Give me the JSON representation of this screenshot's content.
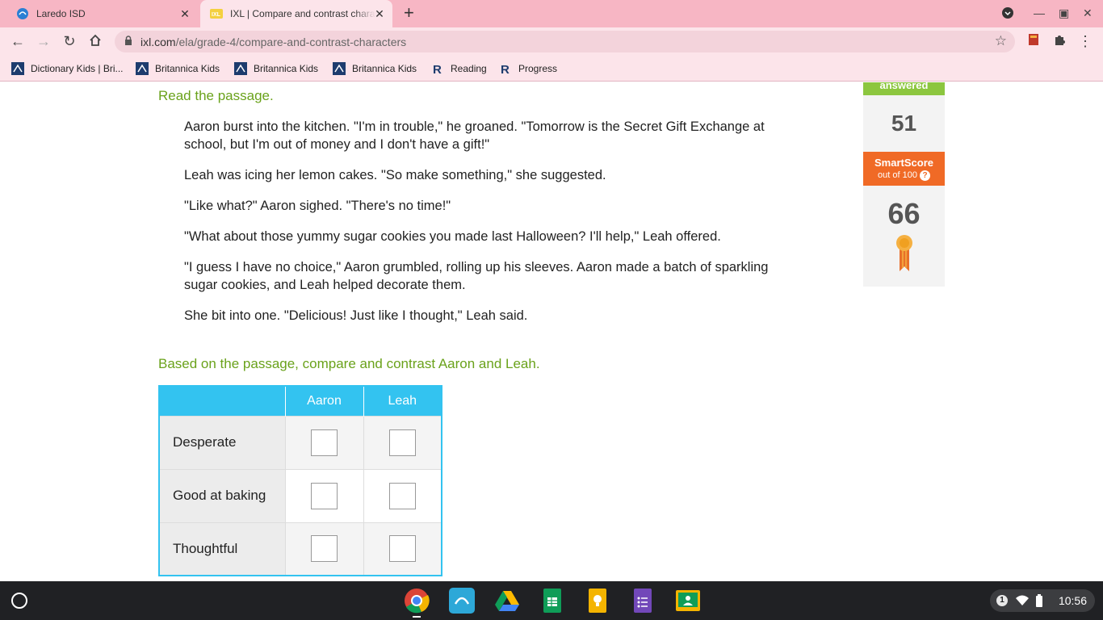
{
  "tabs": [
    {
      "title": "Laredo ISD",
      "icon": "laredo-isd-icon"
    },
    {
      "title": "IXL | Compare and contrast characters",
      "icon": "ixl-icon",
      "active": true
    }
  ],
  "address_bar": {
    "domain": "ixl.com",
    "path": "/ela/grade-4/compare-and-contrast-characters"
  },
  "bookmarks": [
    {
      "label": "Dictionary Kids | Bri...",
      "icon": "britannica-icon"
    },
    {
      "label": "Britannica Kids",
      "icon": "britannica-icon"
    },
    {
      "label": "Britannica Kids",
      "icon": "britannica-icon"
    },
    {
      "label": "Britannica Kids",
      "icon": "britannica-icon"
    },
    {
      "label": "Reading",
      "icon": "reading-r-icon"
    },
    {
      "label": "Progress",
      "icon": "reading-r-icon"
    }
  ],
  "question": {
    "instruction": "Read the passage.",
    "passage": [
      "Aaron burst into the kitchen. \"I'm in trouble,\" he groaned. \"Tomorrow is the Secret Gift Exchange at school, but I'm out of money and I don't have a gift!\"",
      "Leah was icing her lemon cakes. \"So make something,\" she suggested.",
      "\"Like what?\" Aaron sighed. \"There's no time!\"",
      "\"What about those yummy sugar cookies you made last Halloween? I'll help,\" Leah offered.",
      "\"I guess I have no choice,\" Aaron grumbled, rolling up his sleeves. Aaron made a batch of sparkling sugar cookies, and Leah helped decorate them.",
      "She bit into one. \"Delicious! Just like I thought,\" Leah said."
    ],
    "prompt": "Based on the passage, compare and contrast Aaron and Leah.",
    "columns": [
      "Aaron",
      "Leah"
    ],
    "rows": [
      "Desperate",
      "Good at baking",
      "Thoughtful"
    ]
  },
  "sidebar": {
    "answered_label": "answered",
    "questions_answered": "51",
    "smartscore_label": "SmartScore",
    "smartscore_sub": "out of 100",
    "help_glyph": "?",
    "smartscore": "66"
  },
  "shelf": {
    "apps": [
      "chrome-icon",
      "laredo-isd-icon",
      "google-drive-icon",
      "google-sheets-icon",
      "google-keep-icon",
      "google-forms-icon",
      "google-classroom-icon"
    ],
    "notification_count": "1",
    "time": "10:56"
  },
  "colors": {
    "accent_green": "#6aa21b",
    "grid_header": "#33c3f0",
    "smartscore_orange": "#f06a26",
    "tab_strip": "#f7b6c4"
  }
}
